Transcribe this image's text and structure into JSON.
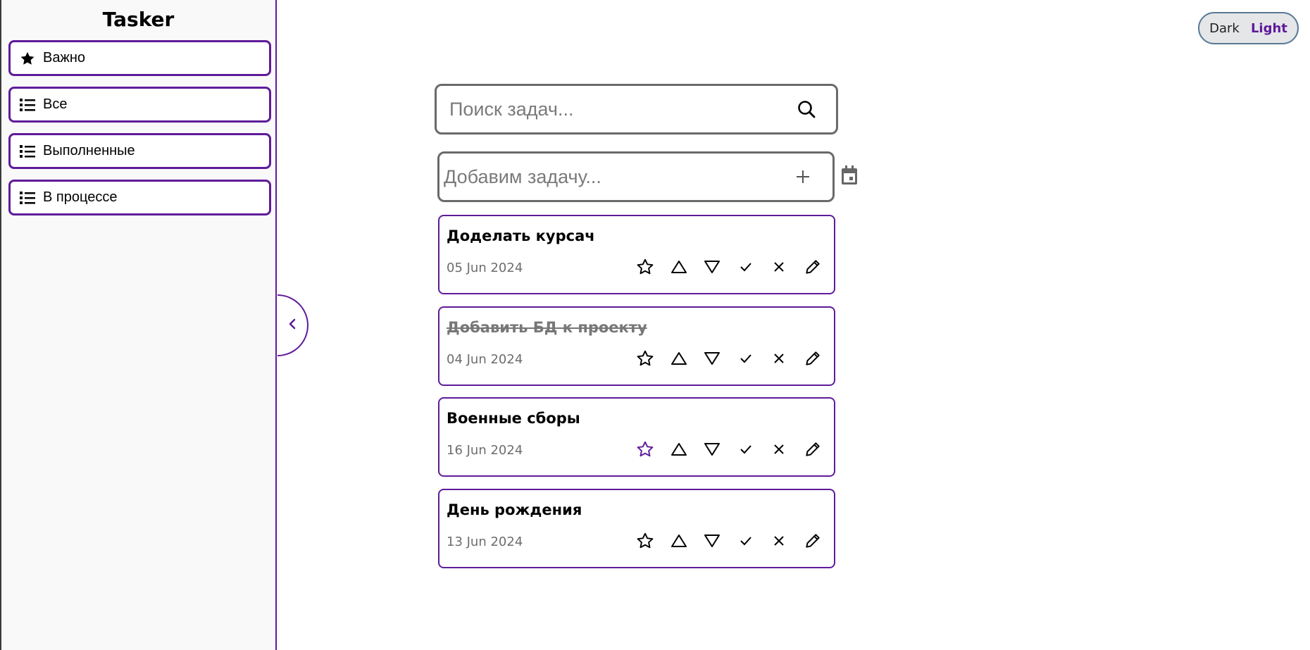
{
  "app": {
    "title": "Tasker"
  },
  "sidebar": {
    "items": [
      {
        "label": "Важно",
        "icon": "star-filled-icon"
      },
      {
        "label": "Все",
        "icon": "list-icon"
      },
      {
        "label": "Выполненные",
        "icon": "list-icon"
      },
      {
        "label": "В процессе",
        "icon": "list-icon"
      }
    ]
  },
  "theme": {
    "dark_label": "Dark",
    "light_label": "Light",
    "active": "Light"
  },
  "search": {
    "placeholder": "Поиск задач...",
    "value": ""
  },
  "add_task": {
    "placeholder": "Добавим задачу...",
    "value": ""
  },
  "tasks": [
    {
      "title": "Доделать курсач",
      "date": "05 Jun 2024",
      "done": false,
      "important": false
    },
    {
      "title": "Добавить БД к проекту",
      "date": "04 Jun 2024",
      "done": true,
      "important": false
    },
    {
      "title": "Военные сборы",
      "date": "16 Jun 2024",
      "done": false,
      "important": true
    },
    {
      "title": "День рождения",
      "date": "13 Jun 2024",
      "done": false,
      "important": false
    }
  ],
  "colors": {
    "accent": "#5f1b9a",
    "border_gray": "#6a6a6a",
    "sidebar_bg": "#f9f9f9"
  }
}
